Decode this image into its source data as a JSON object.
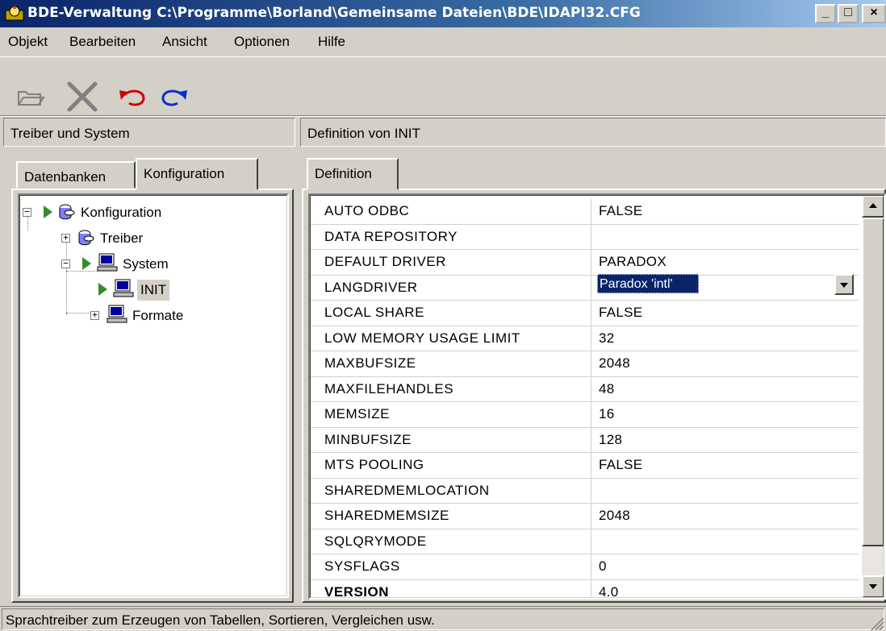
{
  "window": {
    "title": "BDE-Verwaltung  C:\\Programme\\Borland\\Gemeinsame Dateien\\BDE\\IDAPI32.CFG",
    "minimize": "_",
    "maximize": "□",
    "close": "×"
  },
  "menu": [
    "Objekt",
    "Bearbeiten",
    "Ansicht",
    "Optionen",
    "Hilfe"
  ],
  "toolbar": {
    "icons": [
      "open-folder-icon",
      "delete-x-icon",
      "undo-icon",
      "redo-icon"
    ]
  },
  "left_pane": {
    "header": "Treiber und System",
    "tabs": [
      "Datenbanken",
      "Konfiguration"
    ],
    "active_tab": "Konfiguration",
    "tree": [
      {
        "label": "Konfiguration",
        "expander": "−"
      },
      {
        "label": "Treiber",
        "expander": "+"
      },
      {
        "label": "System",
        "expander": "−"
      },
      {
        "label": "INIT",
        "expander": ""
      },
      {
        "label": "Formate",
        "expander": "+"
      }
    ]
  },
  "right_pane": {
    "header": "Definition von INIT",
    "tabs": [
      "Definition"
    ],
    "rows": [
      {
        "name": "AUTO ODBC",
        "value": "FALSE"
      },
      {
        "name": "DATA REPOSITORY",
        "value": ""
      },
      {
        "name": "DEFAULT DRIVER",
        "value": "PARADOX"
      },
      {
        "name": "LANGDRIVER",
        "value": "Paradox 'intl'"
      },
      {
        "name": "LOCAL SHARE",
        "value": "FALSE"
      },
      {
        "name": "LOW MEMORY USAGE LIMIT",
        "value": "32"
      },
      {
        "name": "MAXBUFSIZE",
        "value": "2048"
      },
      {
        "name": "MAXFILEHANDLES",
        "value": "48"
      },
      {
        "name": "MEMSIZE",
        "value": "16"
      },
      {
        "name": "MINBUFSIZE",
        "value": "128"
      },
      {
        "name": "MTS POOLING",
        "value": "FALSE"
      },
      {
        "name": "SHAREDMEMLOCATION",
        "value": ""
      },
      {
        "name": "SHAREDMEMSIZE",
        "value": "2048"
      },
      {
        "name": "SQLQRYMODE",
        "value": ""
      },
      {
        "name": "SYSFLAGS",
        "value": "0"
      },
      {
        "name": "VERSION",
        "value": "4.0"
      }
    ]
  },
  "status": "Sprachtreiber zum Erzeugen von Tabellen, Sortieren, Vergleichen usw.",
  "colors": {
    "title_start": "#0a246a",
    "title_end": "#a6caf0",
    "selection": "#0a246a",
    "tree_arrow": "#2f8f2f"
  }
}
